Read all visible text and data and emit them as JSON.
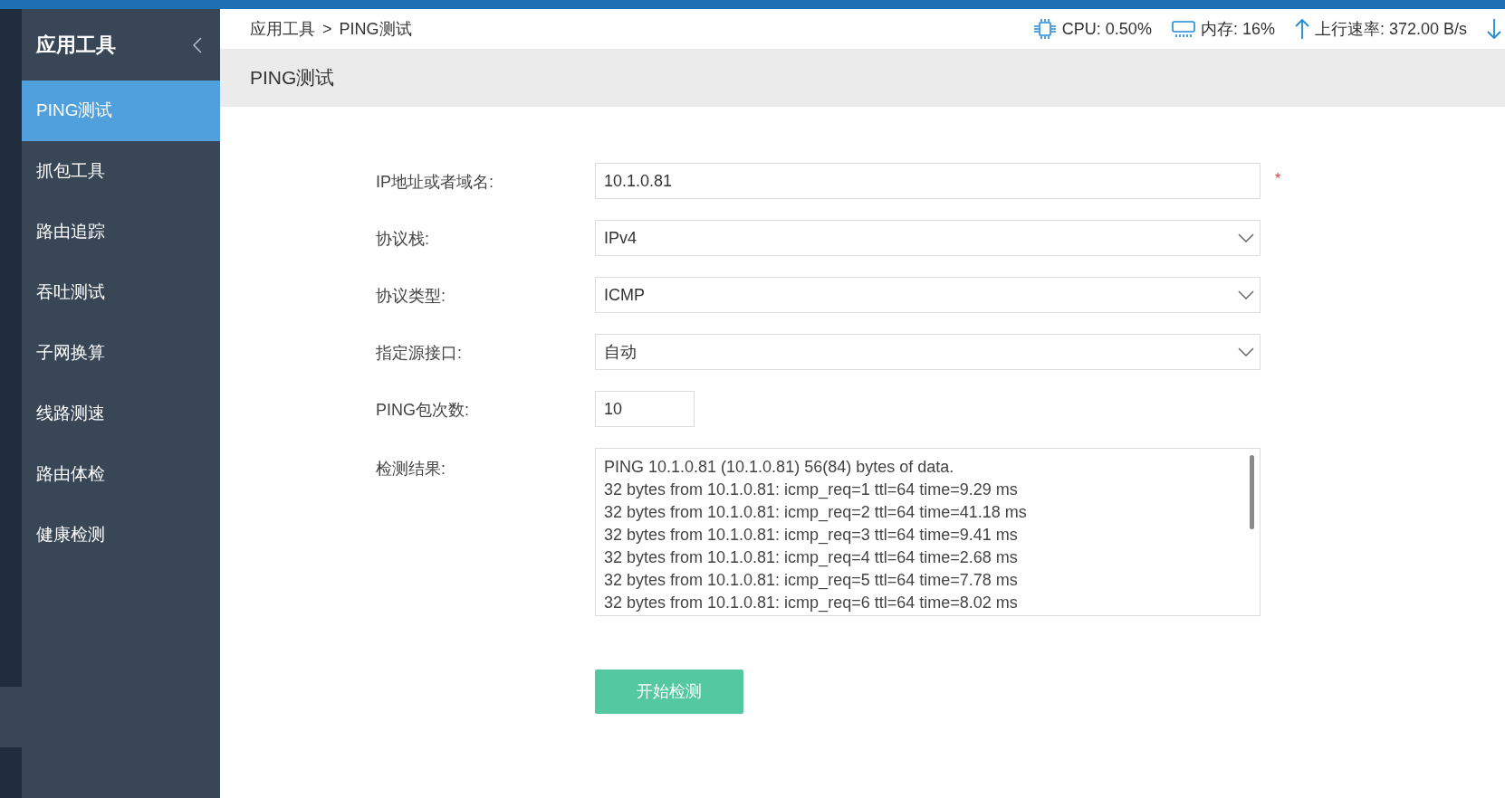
{
  "sidebar": {
    "title": "应用工具",
    "items": [
      {
        "label": "PING测试",
        "selected": true
      },
      {
        "label": "抓包工具",
        "selected": false
      },
      {
        "label": "路由追踪",
        "selected": false
      },
      {
        "label": "吞吐测试",
        "selected": false
      },
      {
        "label": "子网换算",
        "selected": false
      },
      {
        "label": "线路测速",
        "selected": false
      },
      {
        "label": "路由体检",
        "selected": false
      },
      {
        "label": "健康检测",
        "selected": false
      }
    ]
  },
  "header": {
    "breadcrumb": [
      "应用工具",
      "PING测试"
    ],
    "separator": ">",
    "stats": [
      {
        "kind": "cpu",
        "text": "CPU: 0.50%"
      },
      {
        "kind": "memory",
        "text": "内存: 16%"
      },
      {
        "kind": "upload",
        "text": "上行速率: 372.00 B/s"
      },
      {
        "kind": "download"
      }
    ]
  },
  "page_title": "PING测试",
  "form": {
    "fields": [
      {
        "kind": "input",
        "label": "IP地址或者域名:",
        "value": "10.1.0.81",
        "required_mark": "*"
      },
      {
        "kind": "select",
        "label": "协议栈:",
        "value": "IPv4"
      },
      {
        "kind": "select",
        "label": "协议类型:",
        "value": "ICMP"
      },
      {
        "kind": "select",
        "label": "指定源接口:",
        "value": "自动"
      },
      {
        "kind": "count",
        "label": "PING包次数:",
        "value": "10"
      },
      {
        "kind": "output",
        "label": "检测结果:",
        "lines": [
          "PING 10.1.0.81 (10.1.0.81) 56(84) bytes of data.",
          "32 bytes from 10.1.0.81: icmp_req=1 ttl=64 time=9.29 ms",
          "32 bytes from 10.1.0.81: icmp_req=2 ttl=64 time=41.18 ms",
          "32 bytes from 10.1.0.81: icmp_req=3 ttl=64 time=9.41 ms",
          "32 bytes from 10.1.0.81: icmp_req=4 ttl=64 time=2.68 ms",
          "32 bytes from 10.1.0.81: icmp_req=5 ttl=64 time=7.78 ms",
          "32 bytes from 10.1.0.81: icmp_req=6 ttl=64 time=8.02 ms"
        ]
      }
    ],
    "submit": "开始检测"
  }
}
